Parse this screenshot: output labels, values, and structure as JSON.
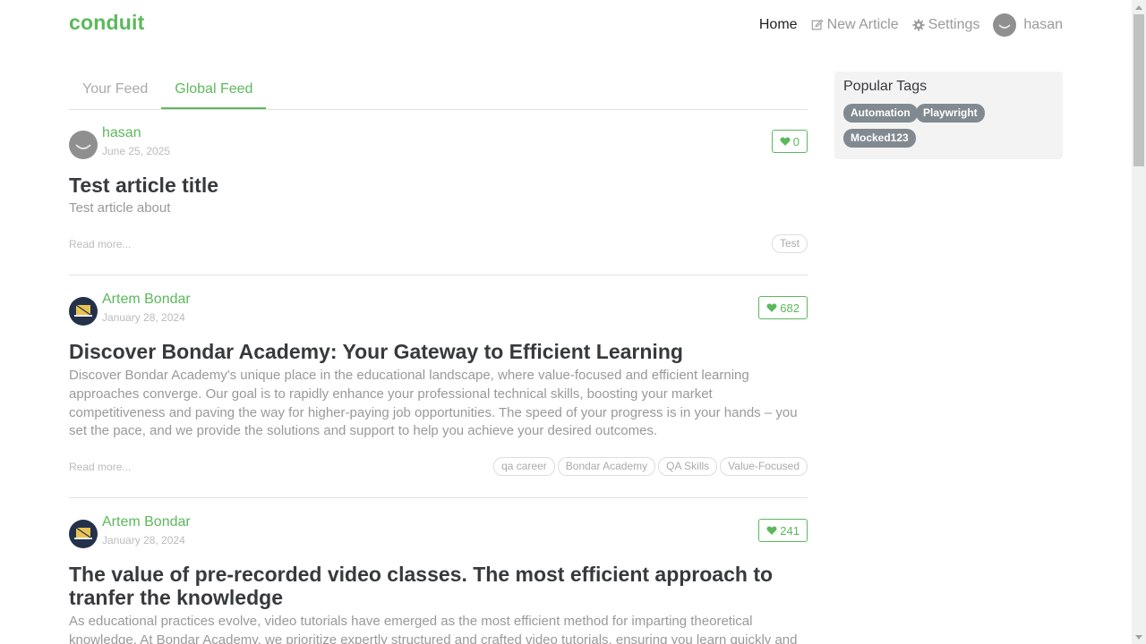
{
  "brand": "conduit",
  "nav": {
    "home": "Home",
    "new_article": "New Article",
    "settings": "Settings",
    "user": "hasan"
  },
  "tabs": {
    "your_feed": "Your Feed",
    "global_feed": "Global Feed"
  },
  "articles": [
    {
      "author": "hasan",
      "date": "June 25, 2025",
      "favorites": "0",
      "title": "Test article title",
      "description": "Test article about",
      "read_more": "Read more...",
      "tags": [
        "Test"
      ]
    },
    {
      "author": "Artem Bondar",
      "date": "January 28, 2024",
      "favorites": "682",
      "title": "Discover Bondar Academy: Your Gateway to Efficient Learning",
      "description": "Discover Bondar Academy's unique place in the educational landscape, where value-focused and efficient learning approaches converge. Our goal is to rapidly enhance your professional technical skills, boosting your market competitiveness and paving the way for higher-paying job opportunities. The speed of your progress is in your hands – you set the pace, and we provide the solutions and support to help you achieve your desired outcomes.",
      "read_more": "Read more...",
      "tags": [
        "qa career",
        "Bondar Academy",
        "QA Skills",
        "Value-Focused"
      ]
    },
    {
      "author": "Artem Bondar",
      "date": "January 28, 2024",
      "favorites": "241",
      "title": "The value of pre-recorded video classes. The most efficient approach to tranfer the knowledge",
      "description": "As educational practices evolve, video tutorials have emerged as the most efficient method for imparting theoretical knowledge. At Bondar Academy, we prioritize expertly structured and crafted video tutorials, ensuring you learn quickly and effectively and"
    }
  ],
  "sidebar": {
    "title": "Popular Tags",
    "tags": [
      "Automation",
      "Playwright",
      "Mocked123"
    ]
  },
  "colors": {
    "brand": "#5cb85c",
    "tag_default": "#818a91",
    "sidebar_bg": "#f3f3f3"
  },
  "icons": {
    "new_article": "edit-icon",
    "settings": "gear-icon",
    "favorite": "heart-icon"
  }
}
